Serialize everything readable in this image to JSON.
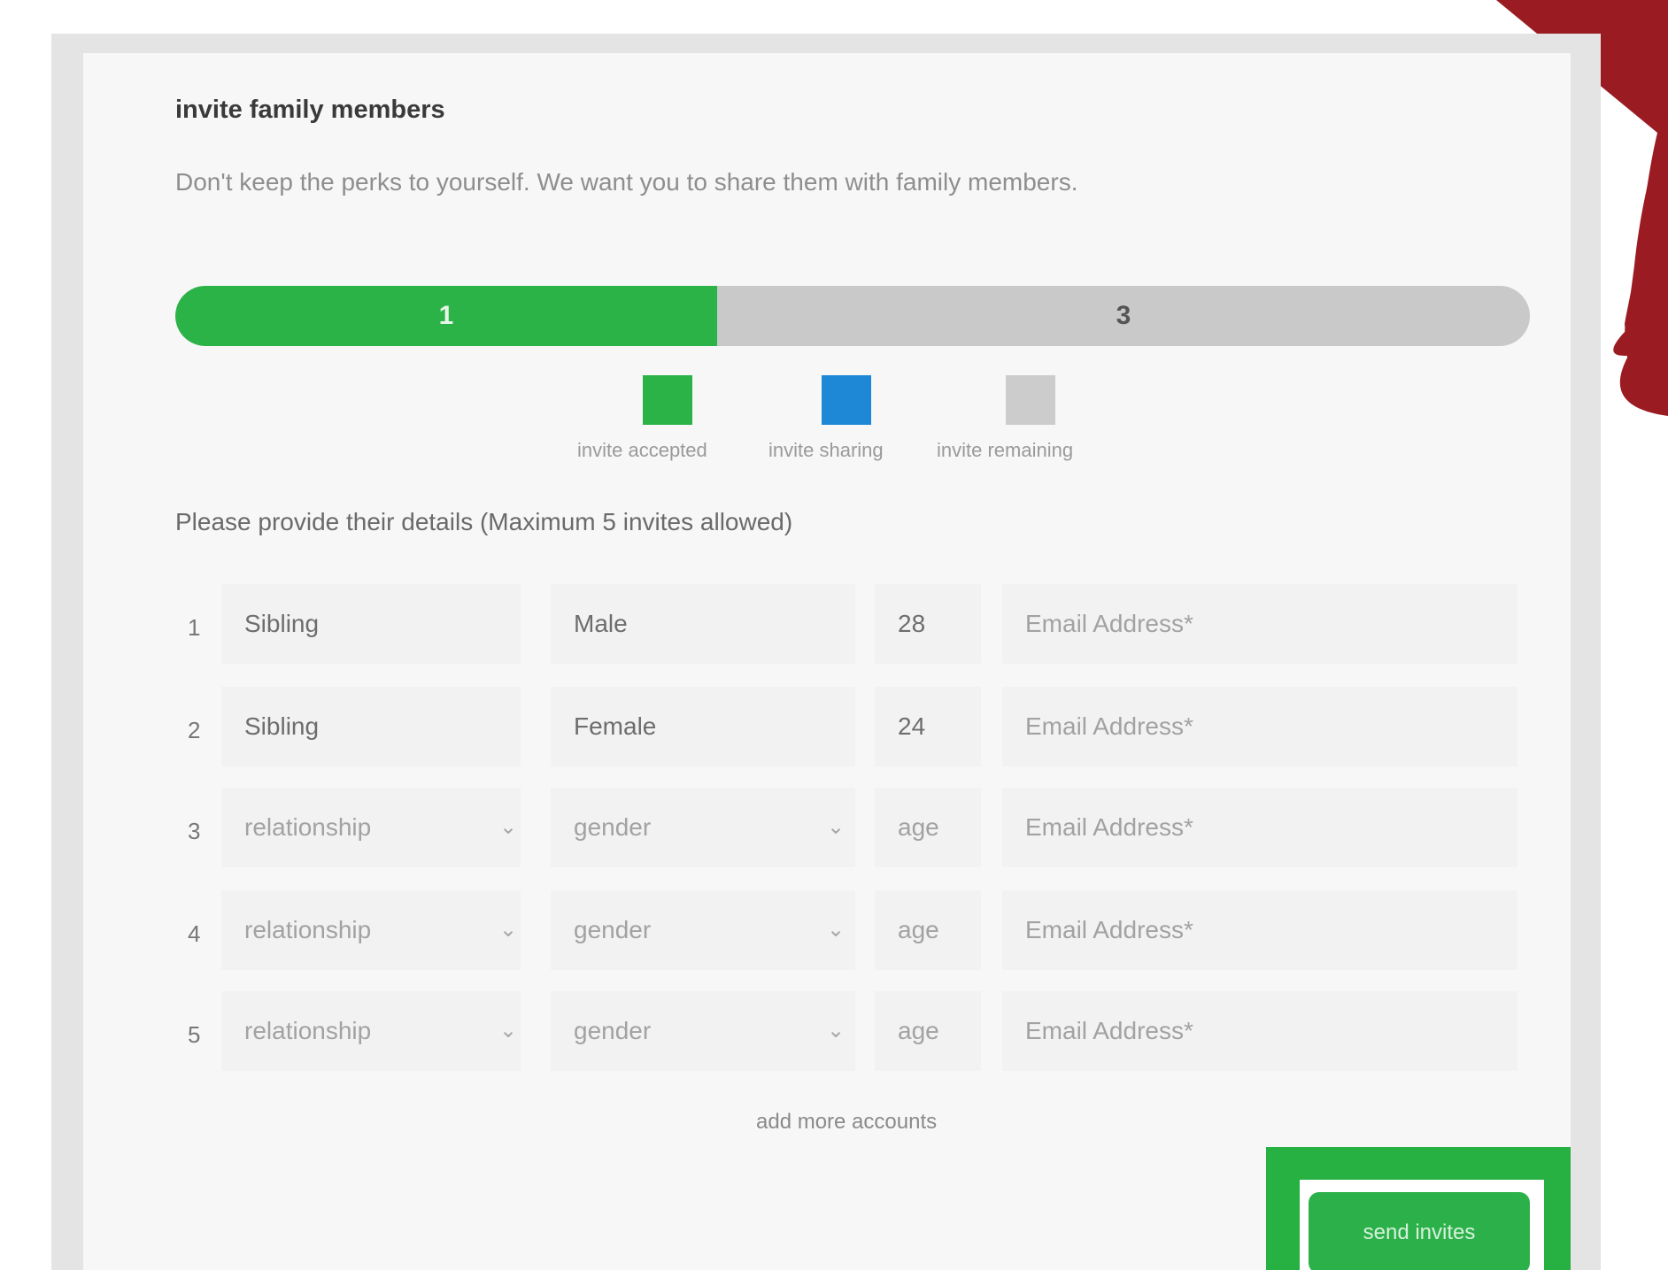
{
  "invite": {
    "title": "invite family members",
    "subtitle": "Don't keep the perks to yourself. We want you to share them with family members.",
    "progress": {
      "accepted": "1",
      "remaining": "3",
      "fraction": 0.4
    },
    "legend": [
      {
        "label": "invite accepted",
        "color": "#2bb347"
      },
      {
        "label": "invite sharing",
        "color": "#1e88d6"
      },
      {
        "label": "invite remaining",
        "color": "#cccccc"
      }
    ],
    "instructions": "Please provide their details (Maximum 5 invites allowed)",
    "rows": [
      {
        "num": "1",
        "relationship": "Sibling",
        "gender": "Male",
        "age": "28",
        "email_placeholder": "Email Address*",
        "filled": true
      },
      {
        "num": "2",
        "relationship": "Sibling",
        "gender": "Female",
        "age": "24",
        "email_placeholder": "Email Address*",
        "filled": true
      },
      {
        "num": "3",
        "relationship": "relationship",
        "gender": "gender",
        "age": "age",
        "email_placeholder": "Email Address*",
        "filled": false
      },
      {
        "num": "4",
        "relationship": "relationship",
        "gender": "gender",
        "age": "age",
        "email_placeholder": "Email Address*",
        "filled": false
      },
      {
        "num": "5",
        "relationship": "relationship",
        "gender": "gender",
        "age": "age",
        "email_placeholder": "Email Address*",
        "filled": false
      }
    ],
    "add_more_label": "add more accounts",
    "send_label": "send invites"
  },
  "colors": {
    "accent": "#2bb347",
    "sharing": "#1e88d6",
    "remaining": "#cccccc",
    "corner_shape": "#9b1b22"
  },
  "icons": {
    "dropdown": "chevron-down-icon"
  }
}
